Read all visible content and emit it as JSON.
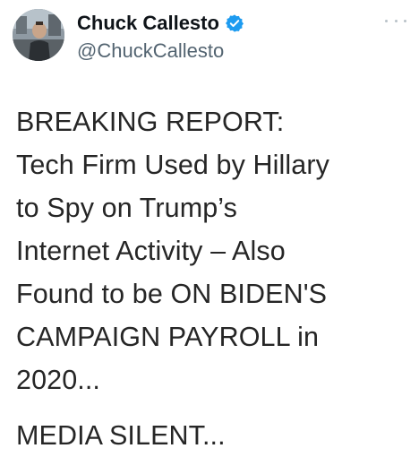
{
  "author": {
    "display_name": "Chuck Callesto",
    "handle": "@ChuckCallesto",
    "verified": true,
    "avatar_icon": "avatar-photo"
  },
  "tweet": {
    "lines": [
      "BREAKING REPORT:",
      "Tech Firm Used by Hillary",
      "to Spy on Trump’s",
      "Internet Activity – Also",
      "Found to be ON BIDEN'S",
      "CAMPAIGN PAYROLL in",
      "2020..."
    ],
    "footer_line": "MEDIA SILENT..."
  },
  "colors": {
    "verified_badge": "#1d9bf0",
    "handle": "#536471",
    "text": "#262626"
  }
}
